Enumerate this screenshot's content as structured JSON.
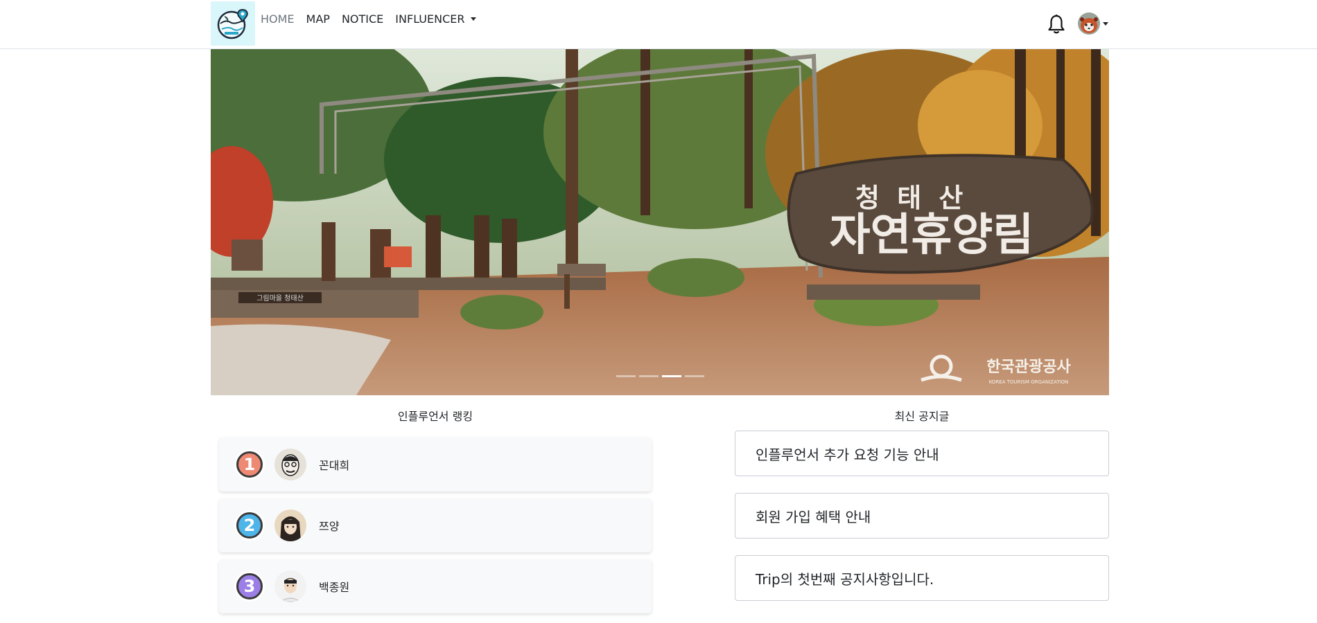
{
  "nav": {
    "links": [
      {
        "label": "HOME",
        "active": true
      },
      {
        "label": "MAP",
        "active": false
      },
      {
        "label": "NOTICE",
        "active": false
      },
      {
        "label": "INFLUENCER",
        "active": false,
        "dropdown": true
      }
    ],
    "icons": {
      "logo": "globe-travel-logo",
      "bell": "bell-icon",
      "avatar": "red-panda-avatar",
      "caret": "caret-down-icon"
    }
  },
  "hero": {
    "image": "forest-park-entrance-sign",
    "sign_line1": "청 태 산",
    "sign_line2": "자연휴양림",
    "plaque": "그림마을 청태산",
    "watermark_ko": "한국관광공사",
    "watermark_en": "KOREA TOURISM ORGANIZATION",
    "slide_count": 4,
    "active_slide": 3
  },
  "ranking": {
    "title": "인플루언서 랭킹",
    "items": [
      {
        "rank": "1",
        "name": "꼰대희",
        "medal_color": "#ee8a74"
      },
      {
        "rank": "2",
        "name": "쯔양",
        "medal_color": "#4fb4e8"
      },
      {
        "rank": "3",
        "name": "백종원",
        "medal_color": "#9b7fe6"
      }
    ]
  },
  "notices": {
    "title": "최신 공지글",
    "items": [
      {
        "text": "인플루언서 추가 요청 기능 안내"
      },
      {
        "text": "회원 가입 혜택 안내"
      },
      {
        "text": "Trip의 첫번째 공지사항입니다."
      }
    ]
  }
}
